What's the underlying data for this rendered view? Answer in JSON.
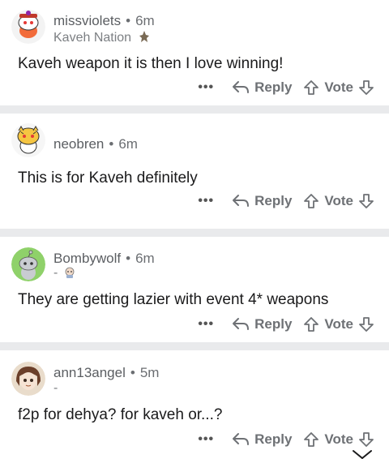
{
  "comments": [
    {
      "username": "missviolets",
      "time": "6m",
      "flair": "Kaveh Nation",
      "body": "Kaveh weapon it is then I love winning!"
    },
    {
      "username": "neobren",
      "time": "6m",
      "flair": "",
      "body": "This is for Kaveh definitely"
    },
    {
      "username": "Bombywolf",
      "time": "6m",
      "flair": "-",
      "body": "They are getting lazier with event 4* weapons"
    },
    {
      "username": "ann13angel",
      "time": "5m",
      "flair": "-",
      "body": "f2p for dehya? for kaveh or...?"
    }
  ],
  "actions": {
    "more": "•••",
    "reply": "Reply",
    "vote": "Vote"
  },
  "separator": "•",
  "colors": {
    "divider": "#e9eaec",
    "meta": "#6b6e72",
    "actions": "#6e7175"
  },
  "icons": {
    "reply": "reply-arrow-icon",
    "upvote": "upvote-arrow-icon",
    "downvote": "downvote-arrow-icon",
    "collapse": "chevron-down-icon"
  }
}
